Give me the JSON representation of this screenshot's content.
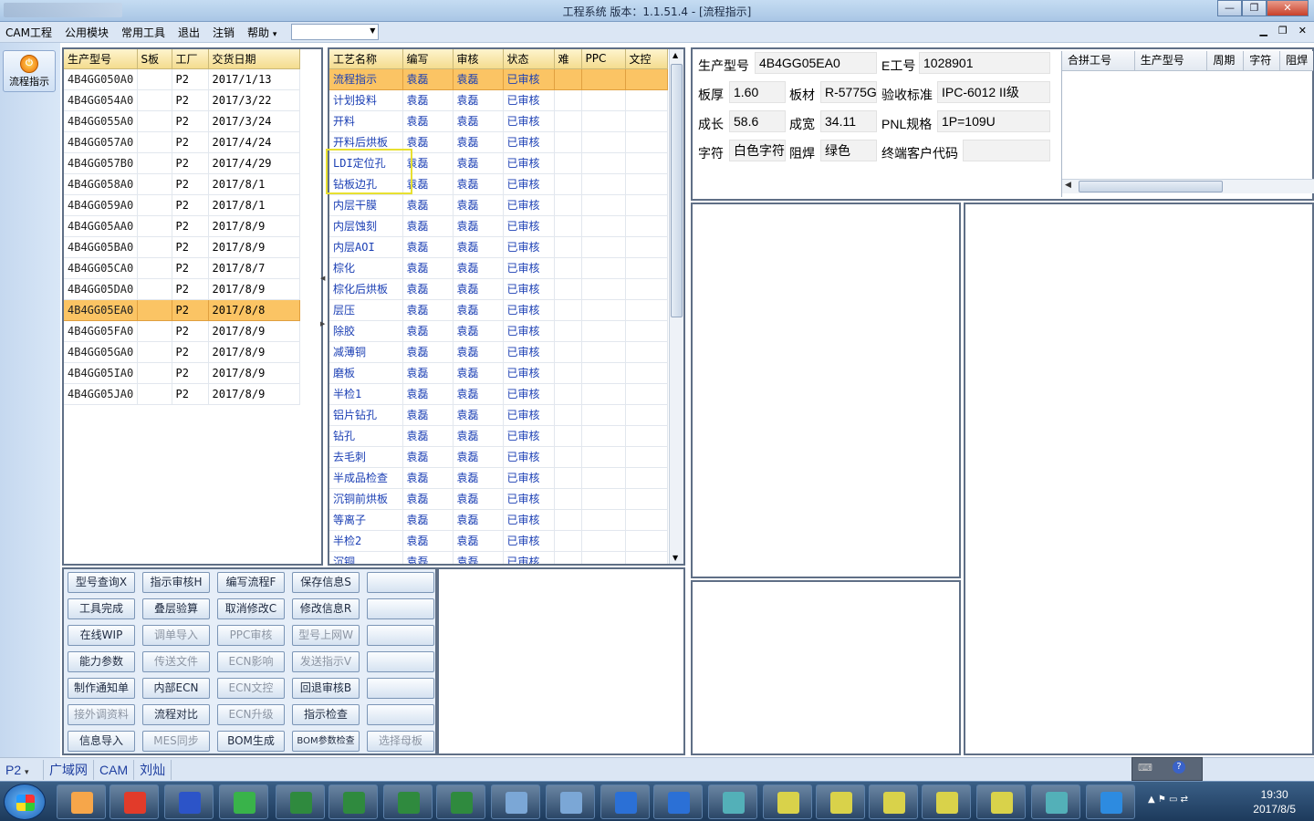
{
  "window": {
    "title": "工程系统    版本：1.1.51.4 - [流程指示]",
    "min": "—",
    "max": "❐",
    "close": "✕"
  },
  "menu": {
    "items": [
      "CAM工程",
      "公用模块",
      "常用工具",
      "退出",
      "注销",
      "帮助"
    ],
    "help_arrow": "▾",
    "dropdown_value": ""
  },
  "leftbar": {
    "flow_button": "流程指示"
  },
  "model_table": {
    "headers": [
      "生产型号",
      "S板",
      "工厂",
      "交货日期"
    ],
    "selected_index": 11,
    "rows": [
      [
        "4B4GG050A0",
        "",
        "P2",
        "2017/1/13"
      ],
      [
        "4B4GG054A0",
        "",
        "P2",
        "2017/3/22"
      ],
      [
        "4B4GG055A0",
        "",
        "P2",
        "2017/3/24"
      ],
      [
        "4B4GG057A0",
        "",
        "P2",
        "2017/4/24"
      ],
      [
        "4B4GG057B0",
        "",
        "P2",
        "2017/4/29"
      ],
      [
        "4B4GG058A0",
        "",
        "P2",
        "2017/8/1"
      ],
      [
        "4B4GG059A0",
        "",
        "P2",
        "2017/8/1"
      ],
      [
        "4B4GG05AA0",
        "",
        "P2",
        "2017/8/9"
      ],
      [
        "4B4GG05BA0",
        "",
        "P2",
        "2017/8/9"
      ],
      [
        "4B4GG05CA0",
        "",
        "P2",
        "2017/8/7"
      ],
      [
        "4B4GG05DA0",
        "",
        "P2",
        "2017/8/9"
      ],
      [
        "4B4GG05EA0",
        "",
        "P2",
        "2017/8/8"
      ],
      [
        "4B4GG05FA0",
        "",
        "P2",
        "2017/8/9"
      ],
      [
        "4B4GG05GA0",
        "",
        "P2",
        "2017/8/9"
      ],
      [
        "4B4GG05IA0",
        "",
        "P2",
        "2017/8/9"
      ],
      [
        "4B4GG05JA0",
        "",
        "P2",
        "2017/8/9"
      ]
    ]
  },
  "process_table": {
    "headers": [
      "工艺名称",
      "编写",
      "审核",
      "状态",
      "难",
      "PPC",
      "文控"
    ],
    "selected_index": 0,
    "rows": [
      [
        "流程指示",
        "袁磊",
        "袁磊",
        "已审核"
      ],
      [
        "计划投料",
        "袁磊",
        "袁磊",
        "已审核"
      ],
      [
        "开料",
        "袁磊",
        "袁磊",
        "已审核"
      ],
      [
        "开料后烘板",
        "袁磊",
        "袁磊",
        "已审核"
      ],
      [
        "LDI定位孔",
        "袁磊",
        "袁磊",
        "已审核"
      ],
      [
        "钻板边孔",
        "袁磊",
        "袁磊",
        "已审核"
      ],
      [
        "内层干膜",
        "袁磊",
        "袁磊",
        "已审核"
      ],
      [
        "内层蚀刻",
        "袁磊",
        "袁磊",
        "已审核"
      ],
      [
        "内层AOI",
        "袁磊",
        "袁磊",
        "已审核"
      ],
      [
        "棕化",
        "袁磊",
        "袁磊",
        "已审核"
      ],
      [
        "棕化后烘板",
        "袁磊",
        "袁磊",
        "已审核"
      ],
      [
        "层压",
        "袁磊",
        "袁磊",
        "已审核"
      ],
      [
        "除胶",
        "袁磊",
        "袁磊",
        "已审核"
      ],
      [
        "减薄铜",
        "袁磊",
        "袁磊",
        "已审核"
      ],
      [
        "磨板",
        "袁磊",
        "袁磊",
        "已审核"
      ],
      [
        "半检1",
        "袁磊",
        "袁磊",
        "已审核"
      ],
      [
        "铝片钻孔",
        "袁磊",
        "袁磊",
        "已审核"
      ],
      [
        "钻孔",
        "袁磊",
        "袁磊",
        "已审核"
      ],
      [
        "去毛刺",
        "袁磊",
        "袁磊",
        "已审核"
      ],
      [
        "半成品检查",
        "袁磊",
        "袁磊",
        "已审核"
      ],
      [
        "沉铜前烘板",
        "袁磊",
        "袁磊",
        "已审核"
      ],
      [
        "等离子",
        "袁磊",
        "袁磊",
        "已审核"
      ],
      [
        "半检2",
        "袁磊",
        "袁磊",
        "已审核"
      ],
      [
        "沉铜",
        "袁磊",
        "袁磊",
        "已审核"
      ]
    ]
  },
  "buttons": [
    [
      {
        "t": "型号查询X"
      },
      {
        "t": "指示审核H"
      },
      {
        "t": "编写流程F"
      },
      {
        "t": "保存信息S"
      },
      {
        "t": ""
      }
    ],
    [
      {
        "t": "工具完成"
      },
      {
        "t": "叠层验算"
      },
      {
        "t": "取消修改C"
      },
      {
        "t": "修改信息R"
      },
      {
        "t": ""
      }
    ],
    [
      {
        "t": "在线WIP"
      },
      {
        "t": "调单导入",
        "dis": true
      },
      {
        "t": "PPC审核",
        "dis": true
      },
      {
        "t": "型号上网W",
        "dis": true
      },
      {
        "t": ""
      }
    ],
    [
      {
        "t": "能力参数"
      },
      {
        "t": "传送文件",
        "dis": true
      },
      {
        "t": "ECN影响",
        "dis": true
      },
      {
        "t": "发送指示V",
        "dis": true
      },
      {
        "t": ""
      }
    ],
    [
      {
        "t": "制作通知单"
      },
      {
        "t": "内部ECN"
      },
      {
        "t": "ECN文控",
        "dis": true
      },
      {
        "t": "回退审核B"
      },
      {
        "t": ""
      }
    ],
    [
      {
        "t": "接外调资料",
        "dis": true
      },
      {
        "t": "流程对比"
      },
      {
        "t": "ECN升级",
        "dis": true
      },
      {
        "t": "指示检查"
      },
      {
        "t": ""
      }
    ],
    [
      {
        "t": "信息导入"
      },
      {
        "t": "MES同步",
        "dis": true
      },
      {
        "t": "BOM生成"
      },
      {
        "t": "BOM参数检查"
      },
      {
        "t": "选择母板",
        "dis": true
      }
    ]
  ],
  "info": {
    "model_label": "生产型号",
    "model": "4B4GG05EA0",
    "eno_label": "E工号",
    "eno": "1028901",
    "thick_label": "板厚",
    "thick": "1.60",
    "mat_label": "板材",
    "mat": "R-5775G",
    "std_label": "验收标准",
    "std": "IPC-6012 II级",
    "len_label": "成长",
    "len": "58.6",
    "wid_label": "成宽",
    "wid": "34.11",
    "pnl_label": "PNL规格",
    "pnl": "1P=109U",
    "char_label": "字符",
    "char": "白色字符",
    "mask_label": "阻焊",
    "mask": "绿色",
    "cust_label": "终端客户代码",
    "cust": ""
  },
  "merge_table": {
    "headers": [
      "合拼工号",
      "生产型号",
      "周期",
      "字符",
      "阻焊"
    ]
  },
  "status": {
    "factory": "P2",
    "items": [
      "广域网",
      "CAM",
      "刘灿"
    ]
  },
  "clock": {
    "time": "19:30",
    "date": "2017/8/5"
  }
}
